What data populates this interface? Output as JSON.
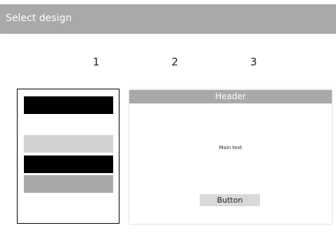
{
  "header": {
    "title": "Select design"
  },
  "design_numbers": [
    "1",
    "2",
    "3"
  ],
  "design_2_preview": {
    "header_text": "Header",
    "main_text": "Main text",
    "button_label": "Button"
  },
  "colors": {
    "header_background": "#a9a9a9",
    "preview_bar_black": "#000000",
    "preview_bar_light_gray": "#d3d3d3",
    "preview_bar_mid_gray": "#a9a9a9",
    "preview_button": "#d9d9d9",
    "selected_border": "#000000"
  }
}
